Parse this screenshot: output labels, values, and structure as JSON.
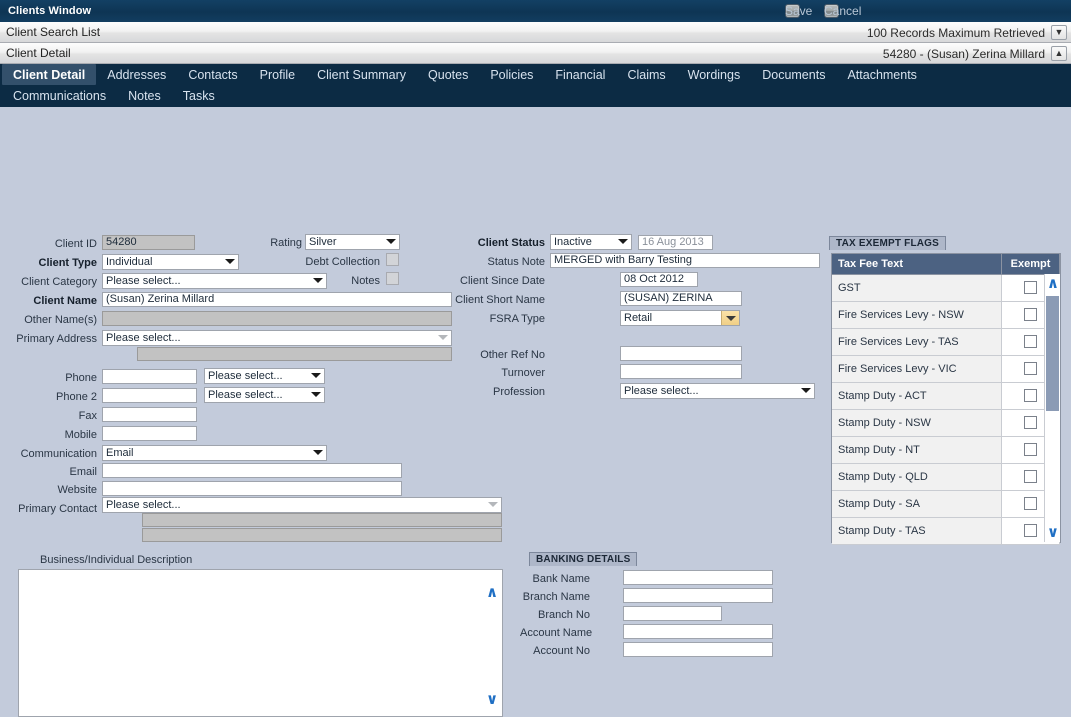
{
  "window": {
    "title": "Clients Window",
    "save_label": "Save",
    "cancel_label": "Cancel"
  },
  "strips": [
    {
      "left": "Client Search List",
      "right": "100 Records Maximum Retrieved",
      "chevron": "▼"
    },
    {
      "left": "Client Detail",
      "right": "54280 - (Susan) Zerina Millard",
      "chevron": "▲"
    }
  ],
  "tabs_row1": [
    {
      "label": "Client Detail",
      "active": true
    },
    {
      "label": "Addresses",
      "active": false
    },
    {
      "label": "Contacts",
      "active": false
    },
    {
      "label": "Profile",
      "active": false
    },
    {
      "label": "Client Summary",
      "active": false
    },
    {
      "label": "Quotes",
      "active": false
    },
    {
      "label": "Policies",
      "active": false
    },
    {
      "label": "Financial",
      "active": false
    },
    {
      "label": "Claims",
      "active": false
    },
    {
      "label": "Wordings",
      "active": false
    },
    {
      "label": "Documents",
      "active": false
    },
    {
      "label": "Attachments",
      "active": false
    }
  ],
  "tabs_row2": [
    {
      "label": "Communications",
      "active": false
    },
    {
      "label": "Notes",
      "active": false
    },
    {
      "label": "Tasks",
      "active": false
    }
  ],
  "left_form": {
    "client_id_label": "Client ID",
    "client_id_value": "54280",
    "client_type_label": "Client Type",
    "client_type_value": "Individual",
    "client_category_label": "Client Category",
    "client_category_value": "Please select...",
    "client_name_label": "Client Name",
    "client_name_value": "(Susan) Zerina Millard",
    "other_names_label": "Other Name(s)",
    "other_names_value": "",
    "primary_address_label": "Primary Address",
    "primary_address_value": "Please select...",
    "primary_address_second_value": "",
    "phone_label": "Phone",
    "phone_value": "",
    "phone_type_value": "Please select...",
    "phone2_label": "Phone 2",
    "phone2_value": "",
    "phone2_type_value": "Please select...",
    "fax_label": "Fax",
    "fax_value": "",
    "mobile_label": "Mobile",
    "mobile_value": "",
    "communication_label": "Communication",
    "communication_value": "Email",
    "email_label": "Email",
    "email_value": "",
    "website_label": "Website",
    "website_value": "",
    "primary_contact_label": "Primary Contact",
    "primary_contact_value": "Please select...",
    "primary_contact_line2": "",
    "primary_contact_line3": "",
    "description_label": "Business/Individual Description",
    "description_value": ""
  },
  "rating_group": {
    "rating_label": "Rating",
    "rating_value": "Silver",
    "debt_collection_label": "Debt Collection",
    "debt_collection_checked": false,
    "notes_label": "Notes",
    "notes_checked": false
  },
  "mid_form": {
    "client_status_label": "Client Status",
    "client_status_value": "Inactive",
    "client_status_date": "16 Aug 2013",
    "status_note_label": "Status Note",
    "status_note_value": "MERGED with Barry Testing",
    "client_since_label": "Client Since Date",
    "client_since_value": "08 Oct 2012",
    "short_name_label": "Client Short Name",
    "short_name_value": "(SUSAN) ZERINA",
    "fsra_type_label": "FSRA Type",
    "fsra_type_value": "Retail",
    "other_ref_label": "Other Ref No",
    "other_ref_value": "",
    "turnover_label": "Turnover",
    "turnover_value": "",
    "profession_label": "Profession",
    "profession_value": "Please select..."
  },
  "banking": {
    "caption": "BANKING DETAILS",
    "bank_name_label": "Bank Name",
    "bank_name_value": "",
    "branch_name_label": "Branch Name",
    "branch_name_value": "",
    "branch_no_label": "Branch No",
    "branch_no_value": "",
    "account_name_label": "Account Name",
    "account_name_value": "",
    "account_no_label": "Account No",
    "account_no_value": ""
  },
  "tax_exempt": {
    "caption": "TAX EXEMPT FLAGS",
    "col_text": "Tax Fee Text",
    "col_exempt": "Exempt",
    "rows": [
      {
        "text": "GST",
        "exempt": false
      },
      {
        "text": "Fire Services Levy - NSW",
        "exempt": false
      },
      {
        "text": "Fire Services Levy - TAS",
        "exempt": false
      },
      {
        "text": "Fire Services Levy - VIC",
        "exempt": false
      },
      {
        "text": "Stamp Duty - ACT",
        "exempt": false
      },
      {
        "text": "Stamp Duty - NSW",
        "exempt": false
      },
      {
        "text": "Stamp Duty - NT",
        "exempt": false
      },
      {
        "text": "Stamp Duty - QLD",
        "exempt": false
      },
      {
        "text": "Stamp Duty - SA",
        "exempt": false
      },
      {
        "text": "Stamp Duty - TAS",
        "exempt": false
      }
    ],
    "scroll_up": "∧",
    "scroll_down": "∨"
  },
  "colors": {
    "titlebar": "#0e3554",
    "tabbar": "#0c2b44",
    "active_tab": "#33506b",
    "canvas": "#c3cbdb",
    "grid_header": "#4c6282",
    "accent_chevron": "#1f6fc4",
    "gold_button": "#f0cf86"
  }
}
